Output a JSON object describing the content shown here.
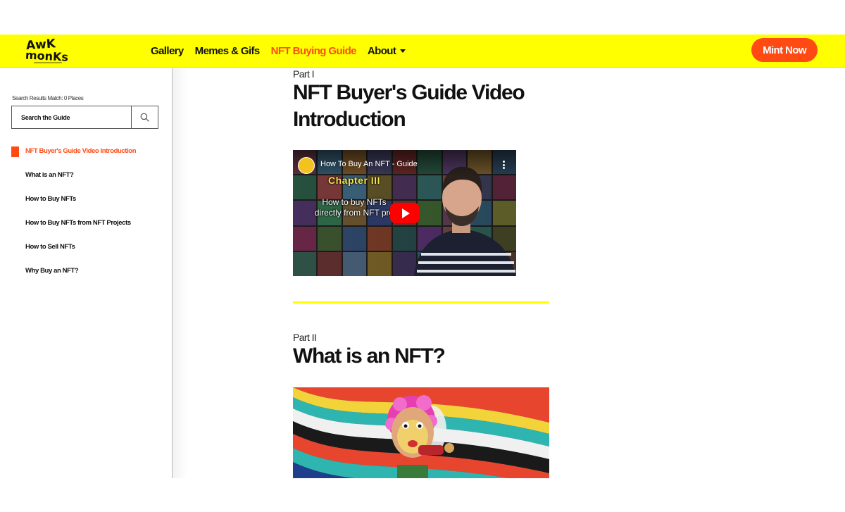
{
  "header": {
    "logo_text": "AwkMonks",
    "nav": [
      {
        "label": "Gallery",
        "active": false
      },
      {
        "label": "Memes & Gifs",
        "active": false
      },
      {
        "label": "NFT Buying Guide",
        "active": true
      },
      {
        "label": "About",
        "active": false,
        "dropdown": true
      }
    ],
    "cta_label": "Mint Now"
  },
  "sidebar": {
    "search_status": "Search Results Match: 0 Places",
    "search_placeholder": "Search the Guide",
    "toc": [
      {
        "label": "NFT Buyer's Guide Video Introduction",
        "active": true
      },
      {
        "label": "What is an NFT?",
        "active": false
      },
      {
        "label": "How to Buy NFTs",
        "active": false
      },
      {
        "label": "How to Buy NFTs from NFT Projects",
        "active": false
      },
      {
        "label": "How to Sell NFTs",
        "active": false
      },
      {
        "label": "Why Buy an NFT?",
        "active": false
      }
    ]
  },
  "main": {
    "sections": [
      {
        "part": "Part I",
        "title_line1": "NFT Buyer's Guide Video",
        "title_line2": "Introduction"
      },
      {
        "part": "Part II",
        "title_line1": "What is an NFT?"
      }
    ],
    "video": {
      "title": "How To Buy An NFT - Guide",
      "chapter": "Chapter III",
      "overlay_line1": "How to buy NFTs",
      "overlay_line2": "directly from NFT pro"
    }
  },
  "colors": {
    "brand_yellow": "#ffff00",
    "accent_orange": "#ff4a14",
    "play_red": "#ff0000"
  },
  "icons": {
    "search": "search-icon",
    "play": "play-icon",
    "more": "more-vertical-icon",
    "caret": "chevron-down-icon"
  }
}
